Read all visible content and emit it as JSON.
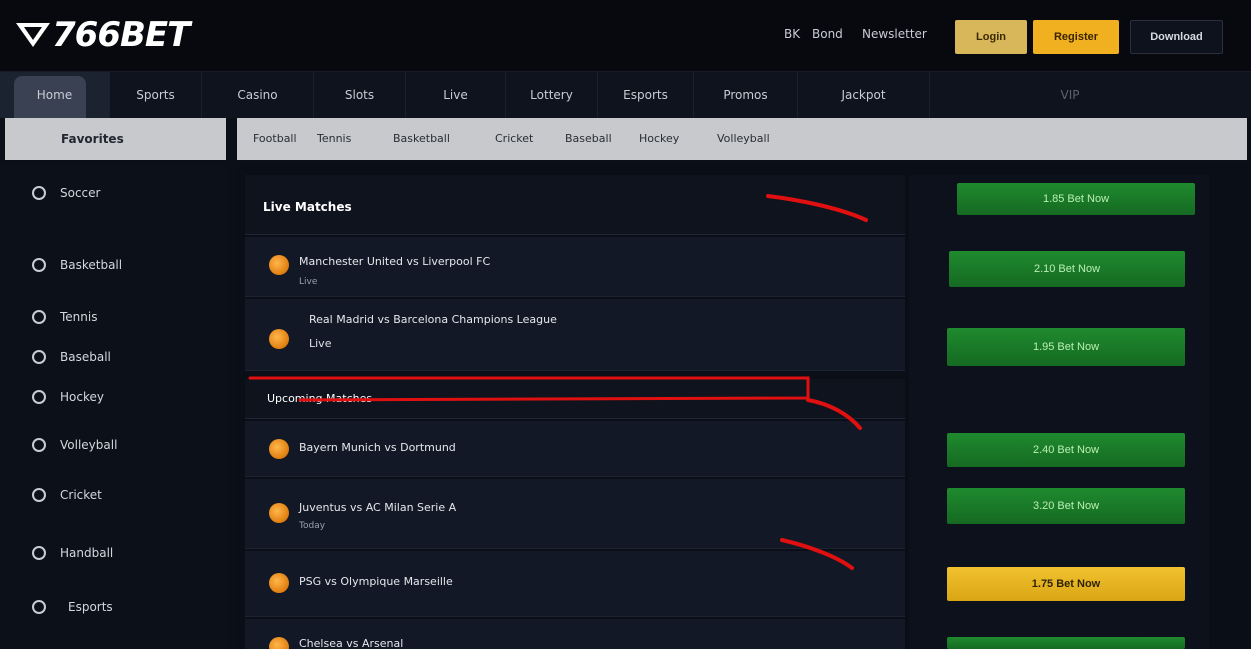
{
  "header": {
    "logo_text": "766BET",
    "links": [
      "BK",
      "Bond",
      "Newsletter"
    ],
    "login_label": "Login",
    "register_label": "Register",
    "download_label": "Download"
  },
  "nav": {
    "tabs": [
      "Home",
      "Sports",
      "Casino",
      "Slots",
      "Live",
      "Lottery",
      "Esports",
      "Promos",
      "Jackpot",
      "VIP"
    ]
  },
  "subbar": {
    "left_label": "Favorites",
    "items": [
      "Football",
      "Tennis",
      "Basketball",
      "Cricket",
      "Baseball",
      "Hockey",
      "Volleyball"
    ]
  },
  "sidebar": {
    "items": [
      "Soccer",
      "Basketball",
      "Tennis",
      "Baseball",
      "Hockey",
      "Volleyball",
      "Cricket",
      "Handball",
      "Esports"
    ]
  },
  "main": {
    "section1_title": "Live Matches",
    "section2_title": "Upcoming Matches",
    "rows": [
      {
        "title": "Manchester United vs Liverpool FC",
        "sub": "Live"
      },
      {
        "title": "Real Madrid vs Barcelona Champions League",
        "sub": "Live"
      },
      {
        "title": "Bayern Munich vs Dortmund",
        "sub": ""
      },
      {
        "title": "Juventus vs AC Milan Serie A",
        "sub": "Today"
      },
      {
        "title": "PSG vs Olympique Marseille",
        "sub": ""
      },
      {
        "title": "Chelsea vs Arsenal",
        "sub": ""
      }
    ],
    "odds": [
      "1.85 Bet Now",
      "2.10 Bet Now",
      "1.95 Bet Now",
      "2.40 Bet Now",
      "3.20 Bet Now",
      "1.75 Bet Now",
      ""
    ]
  },
  "colors": {
    "accent_yellow": "#f0b020",
    "accent_green": "#1f8a2e",
    "annotation_red": "#e01010"
  }
}
